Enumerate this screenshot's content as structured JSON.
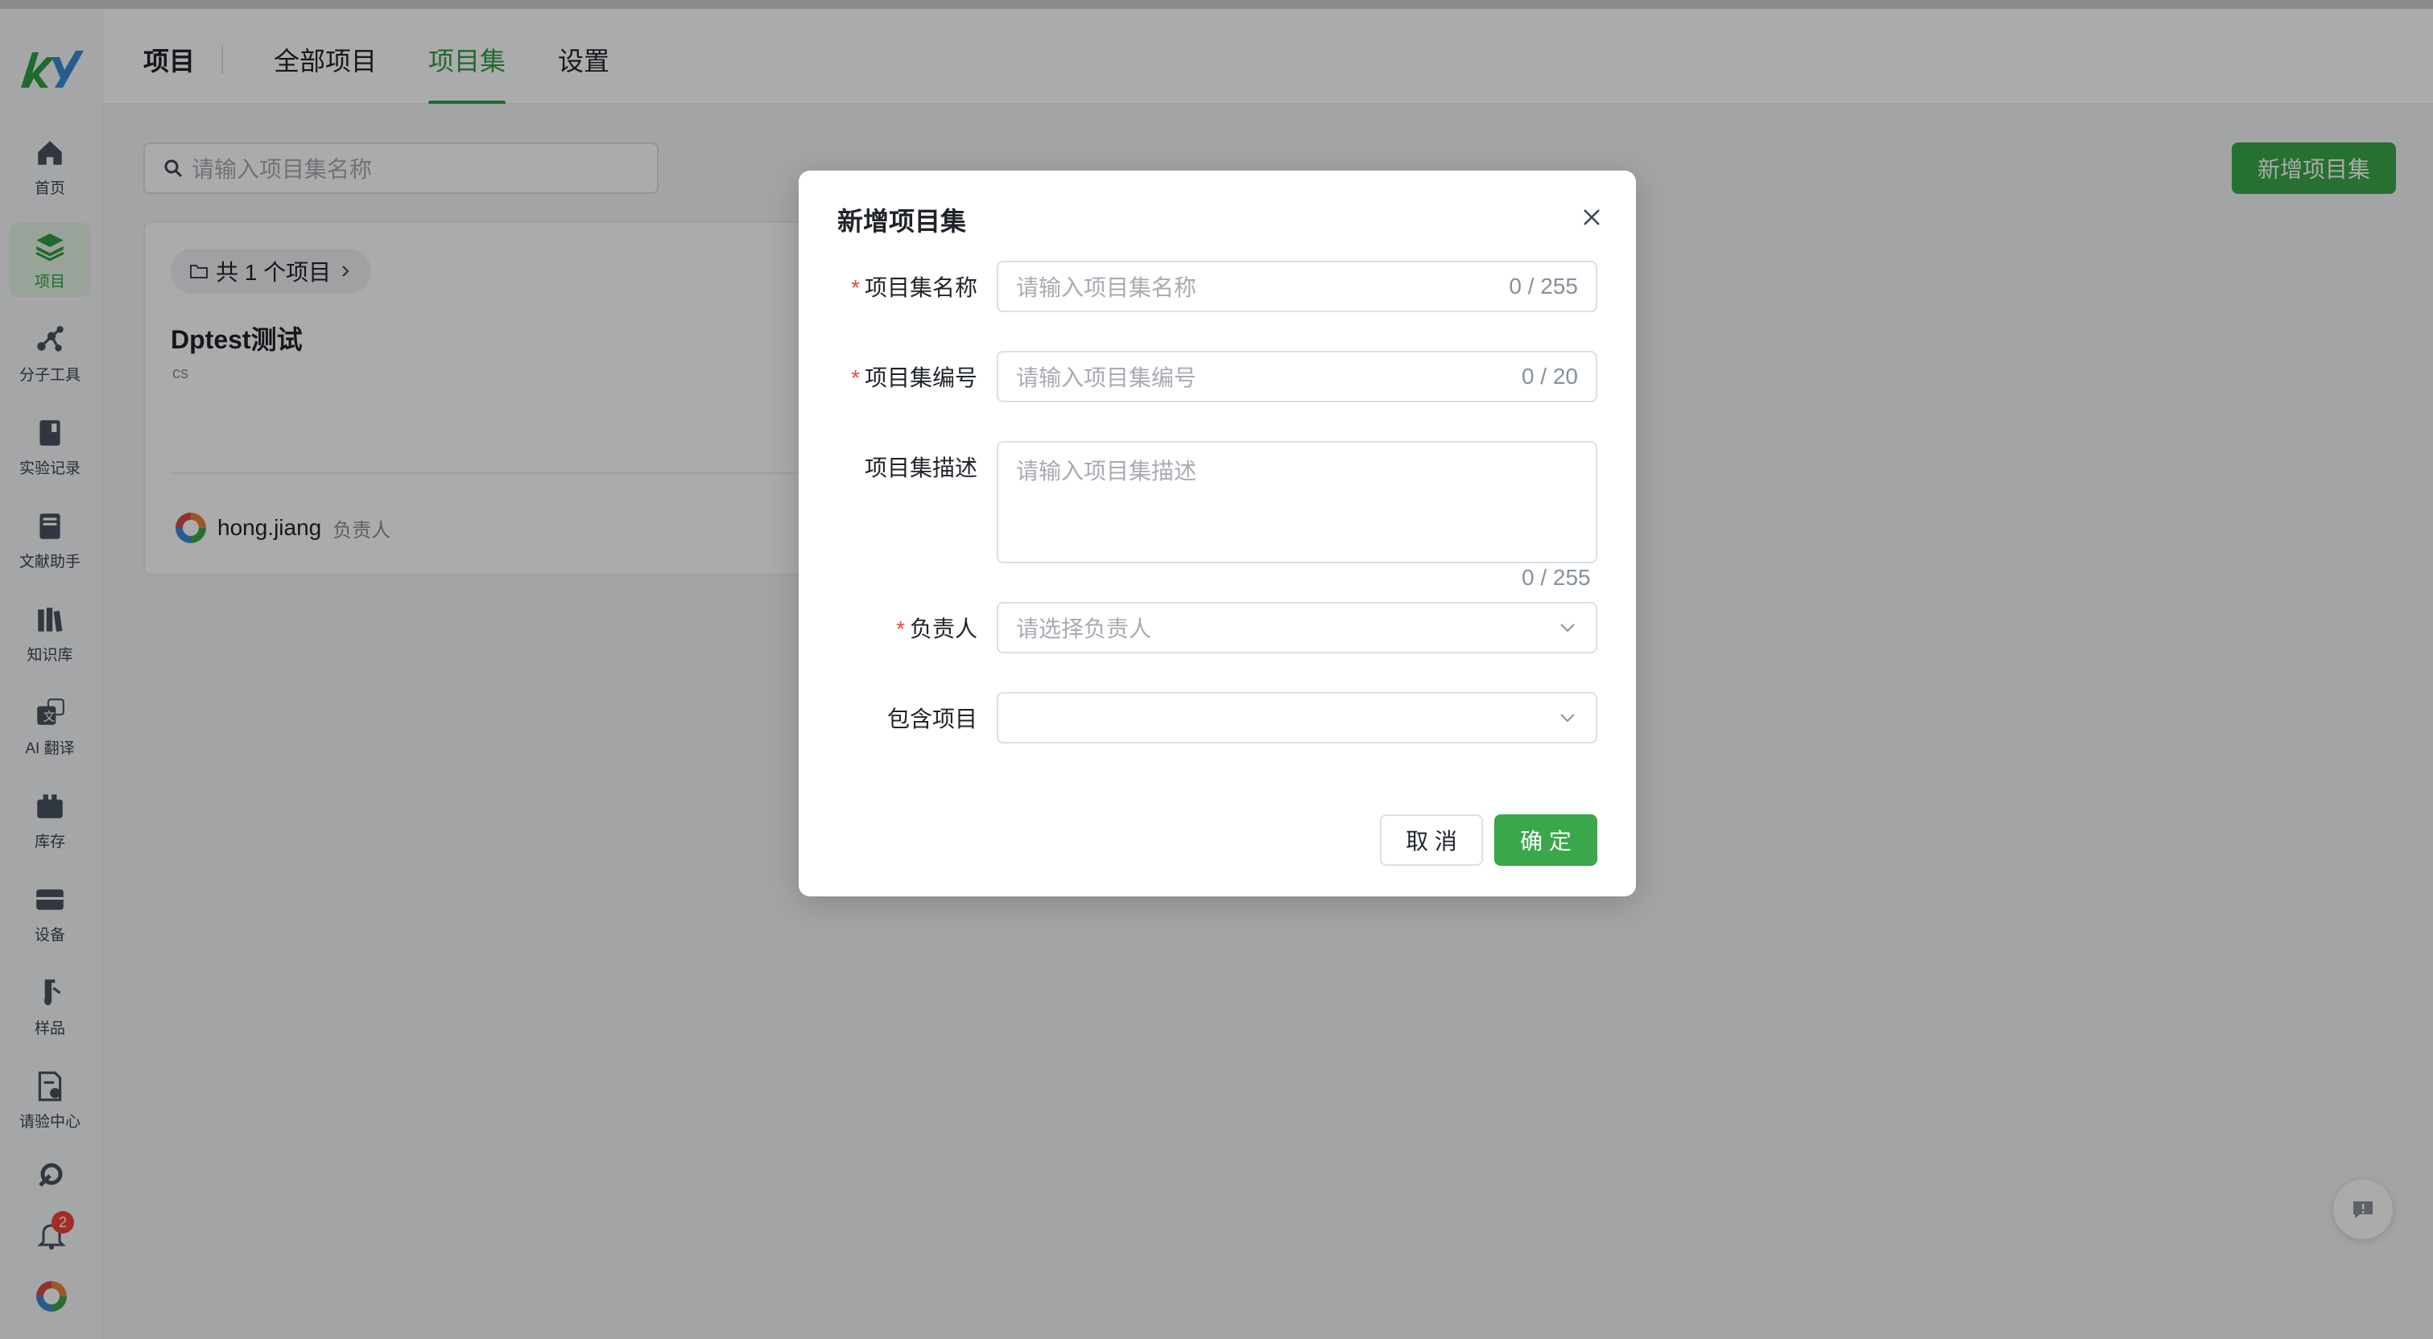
{
  "colors": {
    "accent": "#3aa74a",
    "active_tab": "#2f9e44",
    "required": "#f04438",
    "badge": "#f04438"
  },
  "sidebar": {
    "logo_icon": "app-logo",
    "items": [
      {
        "label": "首页",
        "icon": "home-icon"
      },
      {
        "label": "项目",
        "icon": "layers-icon",
        "active": true
      },
      {
        "label": "分子工具",
        "icon": "molecule-icon"
      },
      {
        "label": "实验记录",
        "icon": "notebook-icon"
      },
      {
        "label": "文献助手",
        "icon": "book-icon"
      },
      {
        "label": "知识库",
        "icon": "library-icon"
      },
      {
        "label": "AI 翻译",
        "icon": "translate-icon"
      },
      {
        "label": "库存",
        "icon": "inventory-icon"
      },
      {
        "label": "设备",
        "icon": "device-icon"
      },
      {
        "label": "样品",
        "icon": "sample-icon"
      },
      {
        "label": "请验中心",
        "icon": "inspection-icon"
      }
    ],
    "bottom": {
      "tools_icon": "wrench-icon",
      "bell_icon": "bell-icon",
      "notification_count": "2",
      "avatar_icon": "avatar-icon"
    }
  },
  "header": {
    "title": "项目",
    "tabs": [
      {
        "label": "全部项目"
      },
      {
        "label": "项目集",
        "active": true
      },
      {
        "label": "设置"
      }
    ]
  },
  "main": {
    "search_placeholder": "请输入项目集名称",
    "new_button": "新增项目集",
    "card": {
      "count_label": "共 1 个项目",
      "title": "Dptest测试",
      "code": "cs",
      "owner_name": "hong.jiang",
      "owner_role": "负责人"
    }
  },
  "modal": {
    "title": "新增项目集",
    "fields": {
      "name": {
        "label": "项目集名称",
        "placeholder": "请输入项目集名称",
        "count": "0 / 255",
        "required": true
      },
      "code": {
        "label": "项目集编号",
        "placeholder": "请输入项目集编号",
        "count": "0 / 20",
        "required": true
      },
      "desc": {
        "label": "项目集描述",
        "placeholder": "请输入项目集描述",
        "count": "0 / 255",
        "required": false
      },
      "owner": {
        "label": "负责人",
        "placeholder": "请选择负责人",
        "required": true
      },
      "projects": {
        "label": "包含项目",
        "placeholder": "",
        "required": false
      }
    },
    "required_mark": "*",
    "cancel": "取 消",
    "confirm": "确 定"
  }
}
